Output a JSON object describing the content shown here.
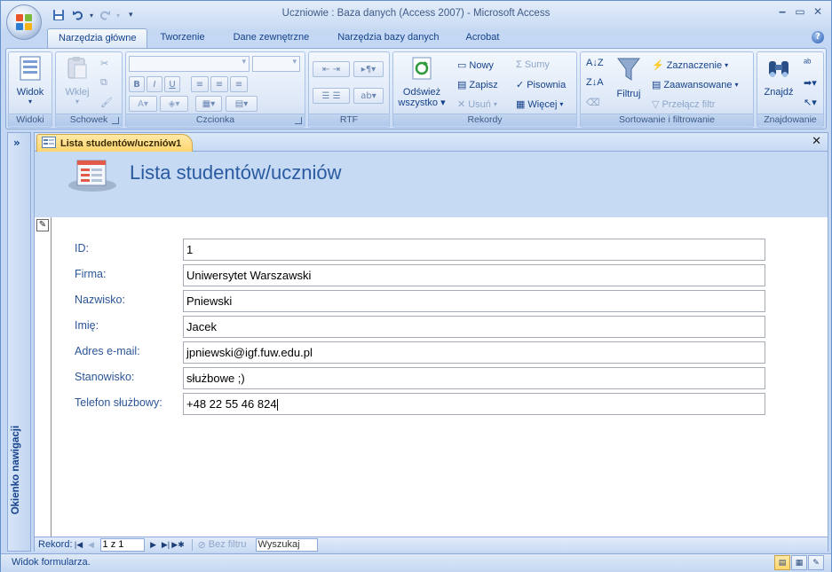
{
  "titlebar": {
    "title": "Uczniowie : Baza danych (Access 2007) - Microsoft Access",
    "icons": [
      "office-button",
      "save-icon",
      "undo-icon",
      "redo-icon",
      "customize-qat-icon",
      "minimize-icon",
      "maximize-icon",
      "close-icon"
    ]
  },
  "ribbon_tabs": [
    {
      "label": "Narzędzia główne",
      "active": true
    },
    {
      "label": "Tworzenie"
    },
    {
      "label": "Dane zewnętrzne"
    },
    {
      "label": "Narzędzia bazy danych"
    },
    {
      "label": "Acrobat"
    }
  ],
  "groups": {
    "widoki": {
      "label": "Widoki",
      "view_button": "Widok"
    },
    "schowek": {
      "label": "Schowek",
      "paste_button": "Wklej"
    },
    "czcionka": {
      "label": "Czcionka",
      "bold": "B",
      "italic": "I",
      "underline": "U"
    },
    "rtf": {
      "label": "RTF"
    },
    "rekordy": {
      "label": "Rekordy",
      "refresh_line1": "Odśwież",
      "refresh_line2": "wszystko",
      "new": "Nowy",
      "save": "Zapisz",
      "delete": "Usuń",
      "totals": "Sumy",
      "spelling": "Pisownia",
      "more": "Więcej"
    },
    "sort": {
      "label": "Sortowanie i filtrowanie",
      "filter": "Filtruj",
      "selection": "Zaznaczenie",
      "advanced": "Zaawansowane",
      "toggle_filter": "Przełącz filtr"
    },
    "znajdowanie": {
      "label": "Znajdowanie",
      "find": "Znajdź"
    }
  },
  "navpane": {
    "label": "Okienko nawigacji",
    "toggle": "»"
  },
  "document": {
    "tab_label": "Lista studentów/uczniów1",
    "form_title": "Lista studentów/uczniów",
    "fields": [
      {
        "label": "ID:",
        "value": "1"
      },
      {
        "label": "Firma:",
        "value": "Uniwersytet Warszawski"
      },
      {
        "label": "Nazwisko:",
        "value": "Pniewski"
      },
      {
        "label": "Imię:",
        "value": "Jacek"
      },
      {
        "label": "Adres e-mail:",
        "value": "jpniewski@igf.fuw.edu.pl"
      },
      {
        "label": "Stanowisko:",
        "value": "służbowe ;)"
      },
      {
        "label": "Telefon służbowy:",
        "value": "+48 22 55 46 824"
      }
    ]
  },
  "record_nav": {
    "label": "Rekord:",
    "position": "1 z 1",
    "filter_status": "Bez filtru",
    "search_placeholder": "Wyszukaj"
  },
  "statusbar": {
    "text": "Widok formularza."
  },
  "colors": {
    "accent": "#15428b",
    "ribbon": "#dbe8f8",
    "active_tab": "#ffd56e",
    "form_header": "#c6daf4"
  }
}
